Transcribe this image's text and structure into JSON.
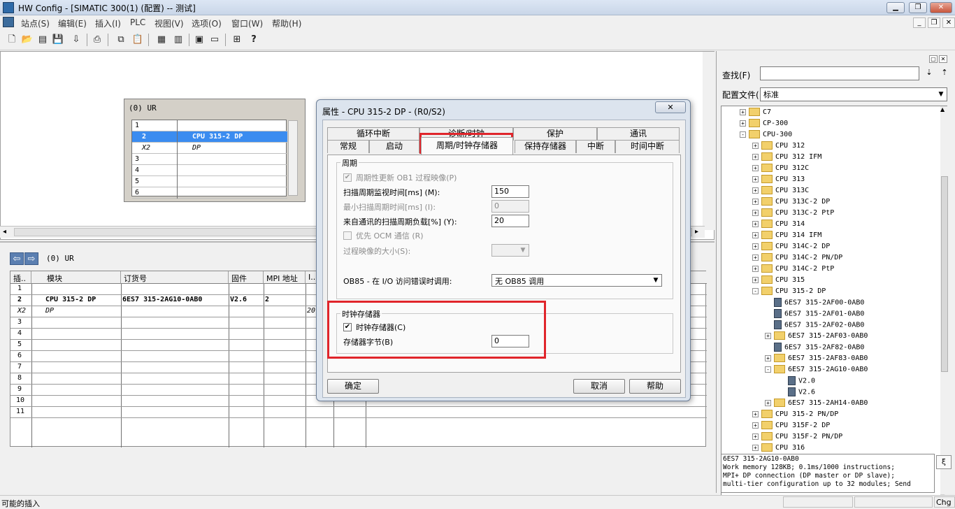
{
  "window": {
    "title": "HW Config - [SIMATIC 300(1) (配置) -- 测试]"
  },
  "menu": [
    "站点(S)",
    "编辑(E)",
    "插入(I)",
    "PLC",
    "视图(V)",
    "选项(O)",
    "窗口(W)",
    "帮助(H)"
  ],
  "toolbar_icons": [
    "new-icon",
    "open-icon",
    "save-compile-icon",
    "save-icon",
    "download-icon",
    "upload-icon",
    "print-icon",
    "copy-icon",
    "paste-icon",
    "catalog-icon",
    "network-icon",
    "hw-catalog-icon",
    "window-icon",
    "help-icon"
  ],
  "rack": {
    "header": "(0) UR",
    "rows": [
      {
        "slot": "1",
        "module": ""
      },
      {
        "slot": "2",
        "module": "CPU 315-2 DP"
      },
      {
        "slot": "X2",
        "module": "DP"
      },
      {
        "slot": "3",
        "module": ""
      },
      {
        "slot": "4",
        "module": ""
      },
      {
        "slot": "5",
        "module": ""
      },
      {
        "slot": "6",
        "module": ""
      }
    ]
  },
  "lower": {
    "rack_label": "(0)   UR",
    "headers": [
      "插..",
      "模块",
      "订货号",
      "固件",
      "MPI 地址",
      "I.."
    ],
    "rows": [
      {
        "slot": "1",
        "module": "",
        "order": "",
        "fw": "",
        "mpi": "",
        "io": ""
      },
      {
        "slot": "2",
        "module": "CPU 315-2 DP",
        "order": "6ES7 315-2AG10-0AB0",
        "fw": "V2.6",
        "mpi": "2",
        "io": ""
      },
      {
        "slot": "X2",
        "module": "DP",
        "order": "",
        "fw": "",
        "mpi": "",
        "io": "20"
      },
      {
        "slot": "3",
        "module": "",
        "order": "",
        "fw": "",
        "mpi": "",
        "io": ""
      },
      {
        "slot": "4",
        "module": "",
        "order": "",
        "fw": "",
        "mpi": "",
        "io": ""
      },
      {
        "slot": "5",
        "module": "",
        "order": "",
        "fw": "",
        "mpi": "",
        "io": ""
      },
      {
        "slot": "6",
        "module": "",
        "order": "",
        "fw": "",
        "mpi": "",
        "io": ""
      },
      {
        "slot": "7",
        "module": "",
        "order": "",
        "fw": "",
        "mpi": "",
        "io": ""
      },
      {
        "slot": "8",
        "module": "",
        "order": "",
        "fw": "",
        "mpi": "",
        "io": ""
      },
      {
        "slot": "9",
        "module": "",
        "order": "",
        "fw": "",
        "mpi": "",
        "io": ""
      },
      {
        "slot": "10",
        "module": "",
        "order": "",
        "fw": "",
        "mpi": "",
        "io": ""
      },
      {
        "slot": "11",
        "module": "",
        "order": "",
        "fw": "",
        "mpi": "",
        "io": ""
      }
    ]
  },
  "dialog": {
    "title": "属性 - CPU 315-2 DP - (R0/S2)",
    "close": "✕",
    "tabs_row1": [
      "循环中断",
      "诊断/时钟",
      "保护",
      "通讯"
    ],
    "tabs_row2": [
      "常规",
      "启动",
      "周期/时钟存储器",
      "保持存储器",
      "中断",
      "时间中断"
    ],
    "cycle_group": "周期",
    "chk_cyclic_update": "周期性更新 OB1 过程映像(P)",
    "scan_monitor_label": "扫描周期监视时间[ms] (M):",
    "scan_monitor_value": "150",
    "min_scan_label": "最小扫描周期时间[ms] (I):",
    "min_scan_value": "0",
    "comm_load_label": "来自通讯的扫描周期负载[%] (Y):",
    "comm_load_value": "20",
    "chk_prio_ocm": "优先 OCM 通信 (R)",
    "process_image_label": "过程映像的大小(S):",
    "ob85_label": "OB85 - 在 I/O 访问错误时调用:",
    "ob85_value": "无 OB85 调用",
    "clock_group": "时钟存储器",
    "chk_clock_memory": "时钟存储器(C)",
    "memory_byte_label": "存储器字节(B)",
    "memory_byte_value": "0",
    "ok": "确定",
    "cancel": "取消",
    "help": "帮助"
  },
  "catalog": {
    "find_label": "查找(F)",
    "profile_label": "配置文件(",
    "profile_value": "标准",
    "tree": [
      {
        "level": 1,
        "type": "folder",
        "exp": "+",
        "label": "C7"
      },
      {
        "level": 1,
        "type": "folder",
        "exp": "+",
        "label": "CP-300"
      },
      {
        "level": 1,
        "type": "folder",
        "exp": "-",
        "label": "CPU-300"
      },
      {
        "level": 2,
        "type": "folder",
        "exp": "+",
        "label": "CPU 312"
      },
      {
        "level": 2,
        "type": "folder",
        "exp": "+",
        "label": "CPU 312 IFM"
      },
      {
        "level": 2,
        "type": "folder",
        "exp": "+",
        "label": "CPU 312C"
      },
      {
        "level": 2,
        "type": "folder",
        "exp": "+",
        "label": "CPU 313"
      },
      {
        "level": 2,
        "type": "folder",
        "exp": "+",
        "label": "CPU 313C"
      },
      {
        "level": 2,
        "type": "folder",
        "exp": "+",
        "label": "CPU 313C-2 DP"
      },
      {
        "level": 2,
        "type": "folder",
        "exp": "+",
        "label": "CPU 313C-2 PtP"
      },
      {
        "level": 2,
        "type": "folder",
        "exp": "+",
        "label": "CPU 314"
      },
      {
        "level": 2,
        "type": "folder",
        "exp": "+",
        "label": "CPU 314 IFM"
      },
      {
        "level": 2,
        "type": "folder",
        "exp": "+",
        "label": "CPU 314C-2 DP"
      },
      {
        "level": 2,
        "type": "folder",
        "exp": "+",
        "label": "CPU 314C-2 PN/DP"
      },
      {
        "level": 2,
        "type": "folder",
        "exp": "+",
        "label": "CPU 314C-2 PtP"
      },
      {
        "level": 2,
        "type": "folder",
        "exp": "+",
        "label": "CPU 315"
      },
      {
        "level": 2,
        "type": "folder",
        "exp": "-",
        "label": "CPU 315-2 DP"
      },
      {
        "level": 3,
        "type": "module",
        "exp": "",
        "label": "6ES7 315-2AF00-0AB0"
      },
      {
        "level": 3,
        "type": "module",
        "exp": "",
        "label": "6ES7 315-2AF01-0AB0"
      },
      {
        "level": 3,
        "type": "module",
        "exp": "",
        "label": "6ES7 315-2AF02-0AB0"
      },
      {
        "level": 3,
        "type": "folder",
        "exp": "+",
        "label": "6ES7 315-2AF03-0AB0"
      },
      {
        "level": 3,
        "type": "module",
        "exp": "",
        "label": "6ES7 315-2AF82-0AB0"
      },
      {
        "level": 3,
        "type": "folder",
        "exp": "+",
        "label": "6ES7 315-2AF83-0AB0"
      },
      {
        "level": 3,
        "type": "folder",
        "exp": "-",
        "label": "6ES7 315-2AG10-0AB0"
      },
      {
        "level": 4,
        "type": "module",
        "exp": "",
        "label": "V2.0"
      },
      {
        "level": 4,
        "type": "module",
        "exp": "",
        "label": "V2.6"
      },
      {
        "level": 3,
        "type": "folder",
        "exp": "+",
        "label": "6ES7 315-2AH14-0AB0"
      },
      {
        "level": 2,
        "type": "folder",
        "exp": "+",
        "label": "CPU 315-2 PN/DP"
      },
      {
        "level": 2,
        "type": "folder",
        "exp": "+",
        "label": "CPU 315F-2 DP"
      },
      {
        "level": 2,
        "type": "folder",
        "exp": "+",
        "label": "CPU 315F-2 PN/DP"
      },
      {
        "level": 2,
        "type": "folder",
        "exp": "+",
        "label": "CPU 316"
      }
    ],
    "info_lines": [
      "6ES7 315-2AG10-0AB0",
      "Work memory 128KB; 0.1ms/1000 instructions;",
      "MPI+ DP connection (DP master or DP slave);",
      "multi-tier configuration up to 32 modules; Send"
    ]
  },
  "status": {
    "text": "可能的插入",
    "right": "Chg"
  },
  "colors": {
    "selection": "#3b8cf0",
    "highlight_box": "#e0252b",
    "accent": "#2e6aa8"
  }
}
